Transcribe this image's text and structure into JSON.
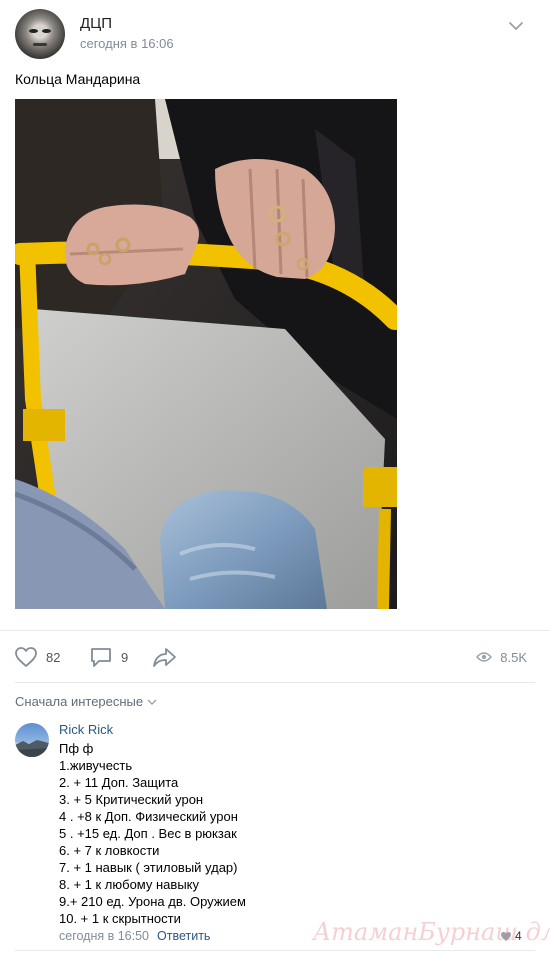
{
  "post": {
    "author": "ДЦП",
    "time": "сегодня в 16:06",
    "text": "Кольца Мандарина",
    "photo_icon": "bus-handrail-hands-photo"
  },
  "actions": {
    "likes": "82",
    "comments": "9",
    "views": "8.5K"
  },
  "comments_section": {
    "sort_label": "Сначала интересные"
  },
  "comment": {
    "author": "Rick Rick",
    "lines": [
      "Пф ф",
      "1.живучесть",
      "2. + 11 Доп. Защита",
      "3. + 5 Критический урон",
      "4 . +8 к Доп. Физический урон",
      "5 . +15 ед. Доп . Вес в рюкзак",
      "6. + 7 к ловкости",
      "7. + 1 навык ( этиловый удар)",
      "8. + 1 к любому навыку",
      "9.+ 210 ед. Урона дв. Оружием",
      "10. + 1 к скрытности"
    ],
    "time": "сегодня в 16:50",
    "reply_label": "Ответить",
    "likes": "4"
  },
  "watermark": "АтаманБурнаш для ЯП",
  "colors": {
    "link": "#2a5885",
    "muted": "#818c99",
    "divider": "#e7e8ec",
    "handrail_yellow": "#f2c200"
  }
}
